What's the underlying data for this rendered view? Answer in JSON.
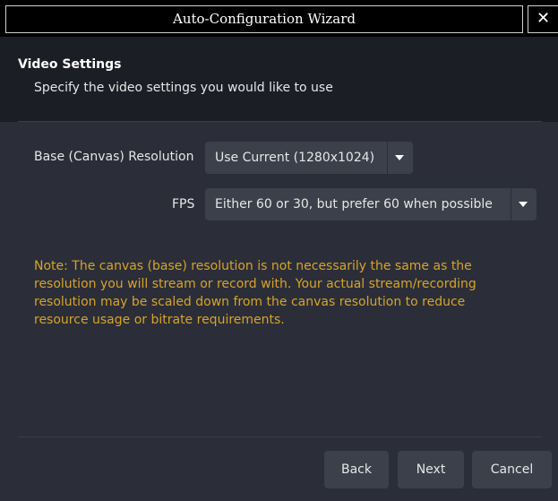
{
  "window": {
    "title": "Auto-Configuration Wizard",
    "close_glyph": "✕"
  },
  "header": {
    "title": "Video Settings",
    "subtitle": "Specify the video settings you would like to use"
  },
  "form": {
    "resolution": {
      "label": "Base (Canvas) Resolution",
      "value": "Use Current (1280x1024)"
    },
    "fps": {
      "label": "FPS",
      "value": "Either 60 or 30, but prefer 60 when possible"
    }
  },
  "note": "Note: The canvas (base) resolution is not necessarily the same as the resolution you will stream or record with. Your actual stream/recording resolution may be scaled down from the canvas resolution to reduce resource usage or bitrate requirements.",
  "buttons": {
    "back": "Back",
    "next": "Next",
    "cancel": "Cancel"
  },
  "colors": {
    "background": "#2b2e38",
    "header_background": "#1c1e25",
    "control": "#3c404b",
    "note_text": "#d7a329"
  },
  "icons": {
    "dropdown": "chevron-down-icon",
    "close": "close-icon"
  }
}
